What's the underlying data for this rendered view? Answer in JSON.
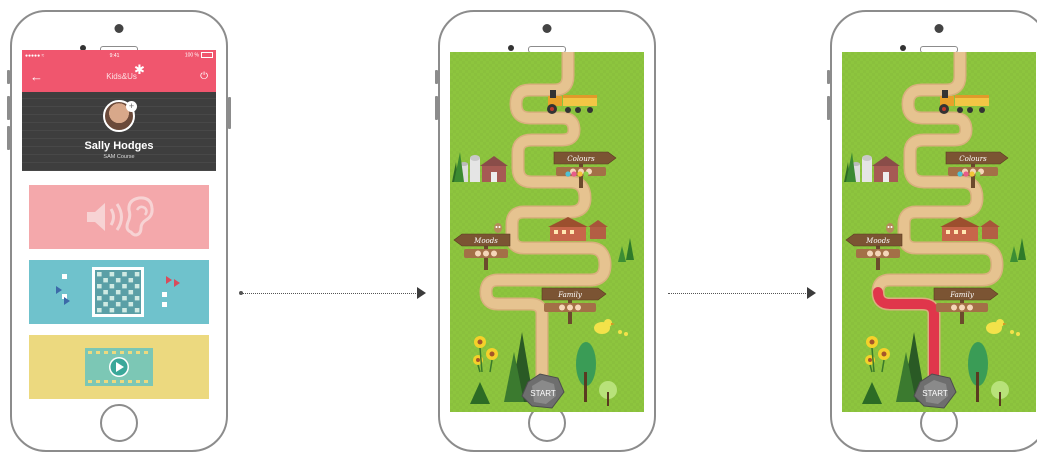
{
  "phone1": {
    "statusbar": {
      "carrier": "●●●●● ≈",
      "time": "9:41",
      "battery": "100 %"
    },
    "appbar": {
      "back_icon": "arrow-left-icon",
      "logo": "Kids&Us",
      "power_icon": "power-icon"
    },
    "profile": {
      "name": "Sally Hodges",
      "course": "SAM Course"
    },
    "tiles": [
      {
        "name": "listen",
        "icon": "speaker-ear-icon"
      },
      {
        "name": "board-game",
        "icon": "game-board-icon"
      },
      {
        "name": "video",
        "icon": "play-icon"
      }
    ],
    "colors": {
      "accent": "#f0566e",
      "listen_tile": "#f4a8ab",
      "board_tile": "#6fc2cc",
      "video_tile": "#ecd97f"
    }
  },
  "map_screen": {
    "signs": {
      "colours": "Colours",
      "moods": "Moods",
      "family": "Family"
    },
    "start": "START",
    "colors": {
      "grass": "#8dc53e",
      "path": "#e6c390",
      "progress": "#e0364b"
    }
  }
}
